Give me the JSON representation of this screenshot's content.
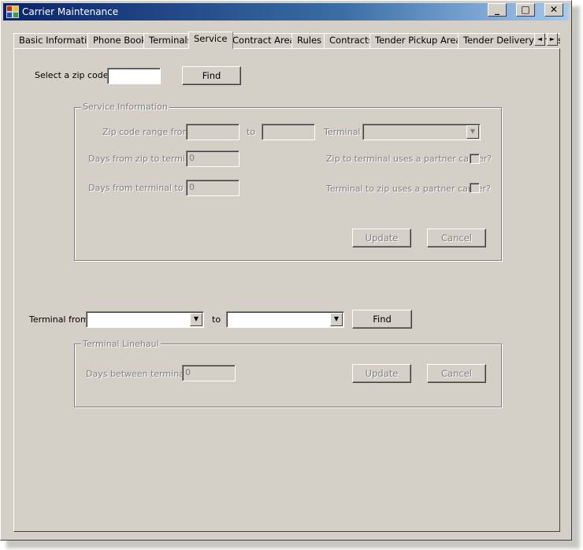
{
  "window": {
    "title": "Carrier Maintenance",
    "buttons": {
      "minimize": "_",
      "maximize": "□",
      "close": "✕"
    }
  },
  "tabs": [
    {
      "label": "Basic Information"
    },
    {
      "label": "Phone Book"
    },
    {
      "label": "Terminals"
    },
    {
      "label": "Service"
    },
    {
      "label": "Contract Areas"
    },
    {
      "label": "Rules"
    },
    {
      "label": "Contracts"
    },
    {
      "label": "Tender Pickup Areas"
    },
    {
      "label": "Tender Delivery Areas"
    }
  ],
  "tab_scroll": {
    "left": "◄",
    "right": "►"
  },
  "zip_search": {
    "label": "Select a zip code",
    "value": "",
    "find_label": "Find"
  },
  "service_info": {
    "legend": "Service Information",
    "zip_range_label": "Zip code range from",
    "zip_from": "",
    "to_label": "to",
    "zip_to": "",
    "terminal_label": "Terminal",
    "terminal_value": "",
    "days_zip_to_terminal_label": "Days from zip to terminal",
    "days_zip_to_terminal": "0",
    "days_terminal_to_zip_label": "Days from terminal to zip",
    "days_terminal_to_zip": "0",
    "zip_to_terminal_partner_label": "Zip to terminal uses a partner carrier?",
    "terminal_to_zip_partner_label": "Terminal to zip uses a partner carrier?",
    "update_label": "Update",
    "cancel_label": "Cancel"
  },
  "terminal_search": {
    "label": "Terminal from",
    "from_value": "",
    "to_label": "to",
    "to_value": "",
    "find_label": "Find"
  },
  "terminal_linehaul": {
    "legend": "Terminal Linehaul",
    "days_between_label": "Days between terminals",
    "days_between": "0",
    "update_label": "Update",
    "cancel_label": "Cancel"
  }
}
